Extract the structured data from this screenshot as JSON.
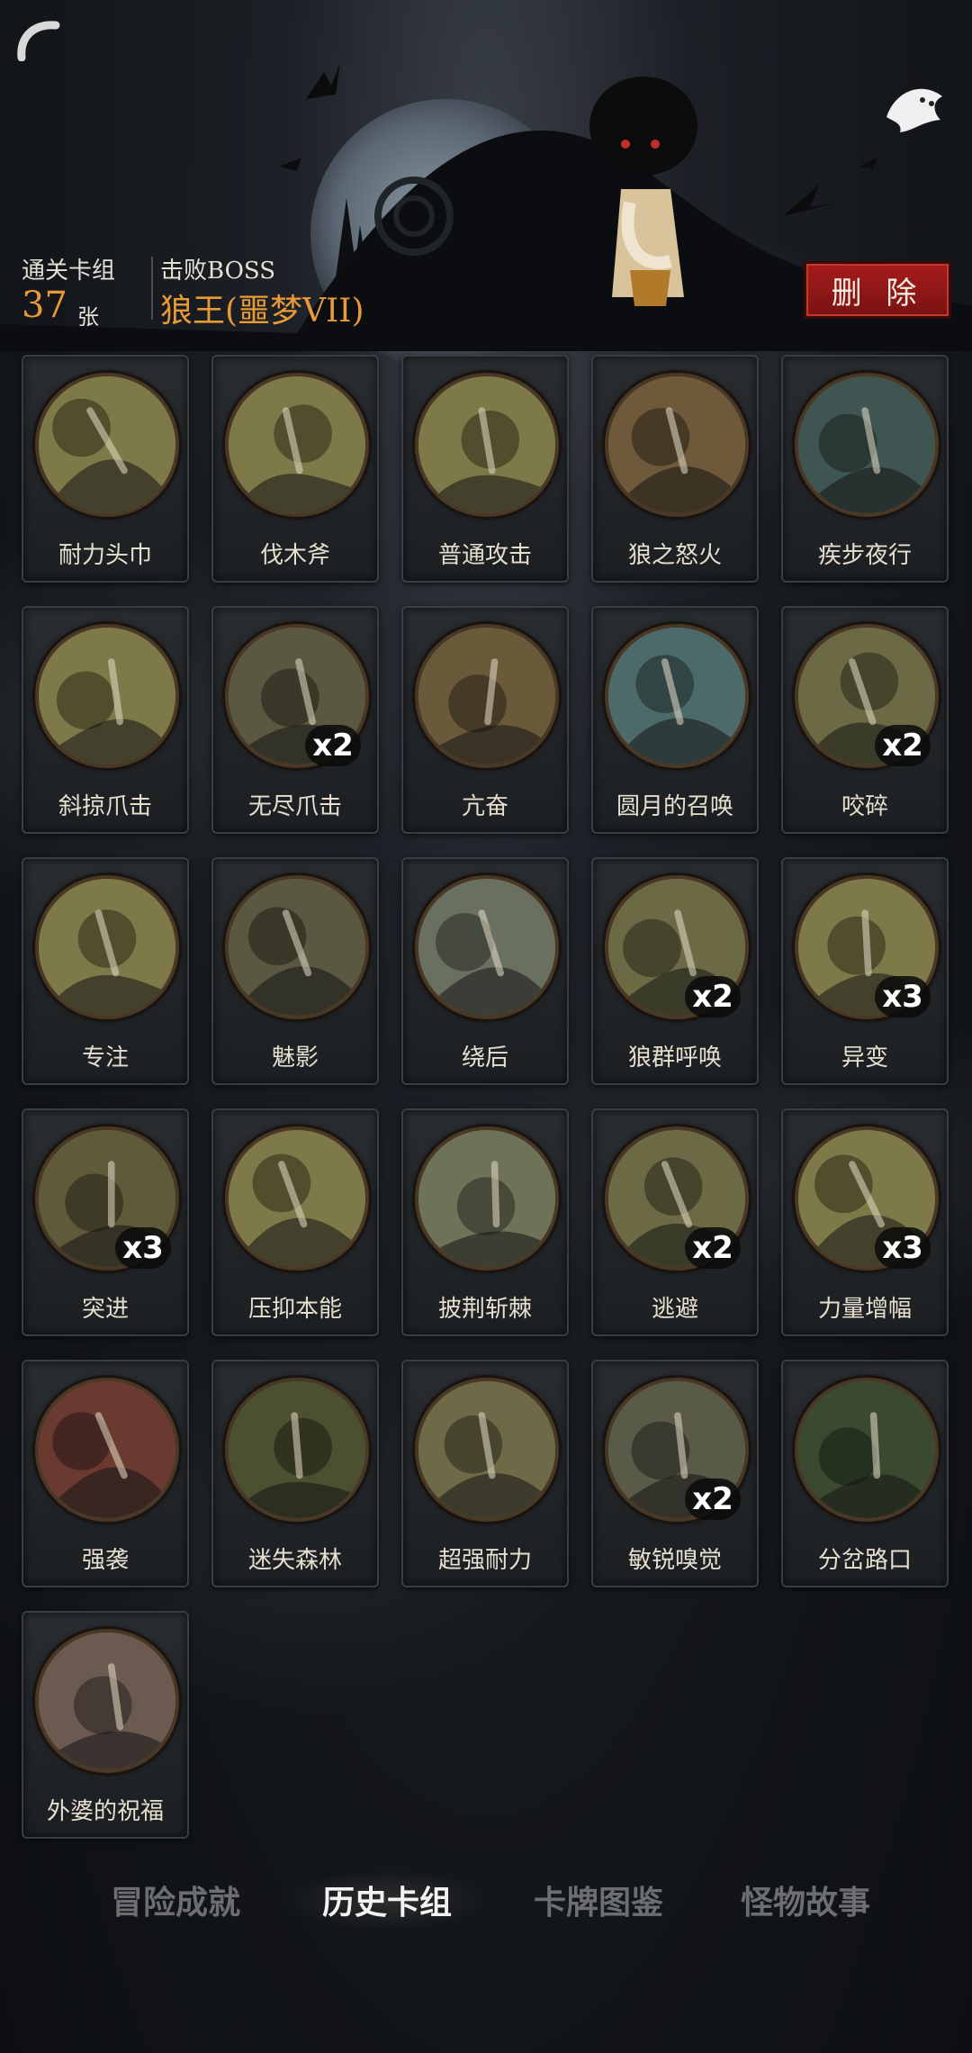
{
  "header": {
    "deck_label": "通关卡组",
    "deck_count": "37",
    "deck_unit": "张",
    "boss_label": "击败BOSS",
    "boss_name": "狼王(噩梦VII)",
    "delete_label": "删 除"
  },
  "cards": [
    {
      "name": "耐力头巾",
      "count": "",
      "icon": "bandana-icon",
      "bg": "#7d7948"
    },
    {
      "name": "伐木斧",
      "count": "",
      "icon": "axe-icon",
      "bg": "#7d7948"
    },
    {
      "name": "普通攻击",
      "count": "",
      "icon": "axe-swing-icon",
      "bg": "#7d7948"
    },
    {
      "name": "狼之怒火",
      "count": "",
      "icon": "wolf-rage-icon",
      "bg": "#6e5a3a"
    },
    {
      "name": "疾步夜行",
      "count": "",
      "icon": "night-walk-icon",
      "bg": "#3f5552"
    },
    {
      "name": "斜掠爪击",
      "count": "",
      "icon": "claw-slash-icon",
      "bg": "#7d7948"
    },
    {
      "name": "无尽爪击",
      "count": "x2",
      "icon": "endless-claw-icon",
      "bg": "#5a5840"
    },
    {
      "name": "亢奋",
      "count": "",
      "icon": "werewolf-frenzy-icon",
      "bg": "#6a5a3a"
    },
    {
      "name": "圆月的召唤",
      "count": "",
      "icon": "full-moon-icon",
      "bg": "#4d6a6a"
    },
    {
      "name": "咬碎",
      "count": "x2",
      "icon": "bite-icon",
      "bg": "#6b6a44"
    },
    {
      "name": "专注",
      "count": "",
      "icon": "wizard-icon",
      "bg": "#7d7948"
    },
    {
      "name": "魅影",
      "count": "",
      "icon": "phantom-icon",
      "bg": "#5a5840"
    },
    {
      "name": "绕后",
      "count": "",
      "icon": "flank-icon",
      "bg": "#6a7060"
    },
    {
      "name": "狼群呼唤",
      "count": "x2",
      "icon": "wolf-pack-icon",
      "bg": "#6b6a44"
    },
    {
      "name": "异变",
      "count": "x3",
      "icon": "mutation-icon",
      "bg": "#7d7948"
    },
    {
      "name": "突进",
      "count": "x3",
      "icon": "charge-icon",
      "bg": "#5e5a3a"
    },
    {
      "name": "压抑本能",
      "count": "",
      "icon": "suppress-icon",
      "bg": "#7d7948"
    },
    {
      "name": "披荆斩棘",
      "count": "",
      "icon": "thorn-cut-icon",
      "bg": "#6e7256"
    },
    {
      "name": "逃避",
      "count": "x2",
      "icon": "escape-icon",
      "bg": "#6b6a44"
    },
    {
      "name": "力量增幅",
      "count": "x3",
      "icon": "strength-icon",
      "bg": "#7d7948"
    },
    {
      "name": "强袭",
      "count": "",
      "icon": "assault-icon",
      "bg": "#6a3a30"
    },
    {
      "name": "迷失森林",
      "count": "",
      "icon": "lost-forest-icon",
      "bg": "#4a5030"
    },
    {
      "name": "超强耐力",
      "count": "",
      "icon": "super-stamina-icon",
      "bg": "#6e6a48"
    },
    {
      "name": "敏锐嗅觉",
      "count": "x2",
      "icon": "keen-smell-icon",
      "bg": "#5a5a48"
    },
    {
      "name": "分岔路口",
      "count": "",
      "icon": "crossroad-icon",
      "bg": "#3a4a30"
    },
    {
      "name": "外婆的祝福",
      "count": "",
      "icon": "grandma-blessing-icon",
      "bg": "#6a5a50"
    }
  ],
  "tabs": [
    {
      "label": "冒险成就",
      "active": false
    },
    {
      "label": "历史卡组",
      "active": true
    },
    {
      "label": "卡牌图鉴",
      "active": false
    },
    {
      "label": "怪物故事",
      "active": false
    }
  ]
}
